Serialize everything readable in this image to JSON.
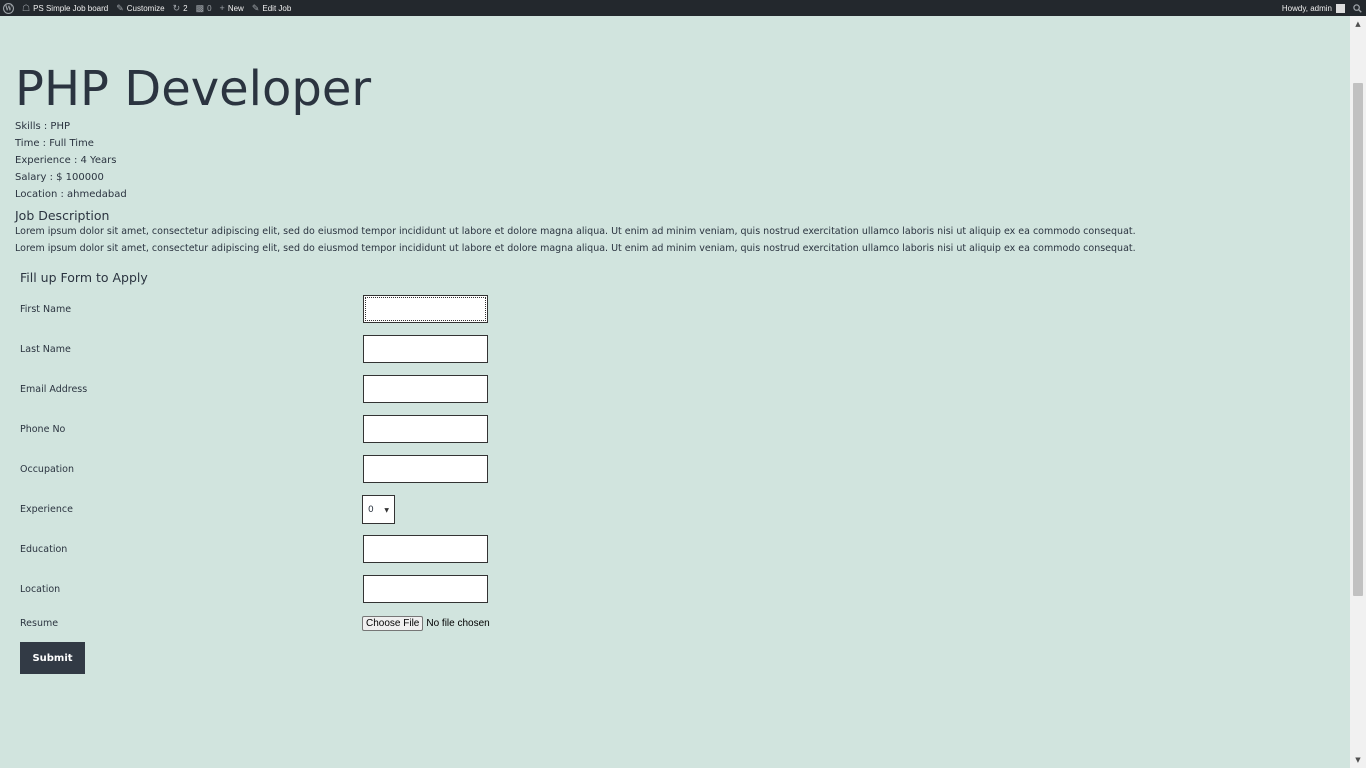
{
  "admin_bar": {
    "site_name": "PS Simple Job board",
    "customize": "Customize",
    "updates_count": "2",
    "comments_count": "0",
    "new_label": "New",
    "edit_label": "Edit Job",
    "howdy": "Howdy, admin"
  },
  "job": {
    "title": "PHP Developer",
    "skills": "Skills : PHP",
    "time": "Time : Full Time",
    "experience": "Experience : 4 Years",
    "salary": "Salary : $ 100000",
    "location": "Location : ahmedabad",
    "description_heading": "Job Description",
    "description_lines": [
      "Lorem ipsum dolor sit amet, consectetur adipiscing elit, sed do eiusmod tempor incididunt ut labore et dolore magna aliqua. Ut enim ad minim veniam, quis nostrud exercitation ullamco laboris nisi ut aliquip ex ea commodo consequat.",
      "Lorem ipsum dolor sit amet, consectetur adipiscing elit, sed do eiusmod tempor incididunt ut labore et dolore magna aliqua. Ut enim ad minim veniam, quis nostrud exercitation ullamco laboris nisi ut aliquip ex ea commodo consequat."
    ]
  },
  "form": {
    "heading": "Fill up Form to Apply",
    "fields": {
      "first_name": {
        "label": "First Name",
        "value": ""
      },
      "last_name": {
        "label": "Last Name",
        "value": ""
      },
      "email": {
        "label": "Email Address",
        "value": ""
      },
      "phone": {
        "label": "Phone No",
        "value": ""
      },
      "occupation": {
        "label": "Occupation",
        "value": ""
      },
      "experience": {
        "label": "Experience",
        "value": "0"
      },
      "education": {
        "label": "Education",
        "value": ""
      },
      "location": {
        "label": "Location",
        "value": ""
      },
      "resume": {
        "label": "Resume",
        "button": "Choose File",
        "status": "No file chosen"
      }
    },
    "submit_label": "Submit"
  },
  "icons": {
    "wp_logo": "wordpress-icon",
    "site": "home-icon",
    "customize": "brush-icon",
    "updates": "refresh-icon",
    "comments": "comment-icon",
    "new": "plus-icon",
    "edit": "pencil-icon",
    "search": "search-icon"
  },
  "colors": {
    "page_background": "#d1e4de",
    "admin_bar": "#23282d",
    "submit_button": "#323a45"
  }
}
